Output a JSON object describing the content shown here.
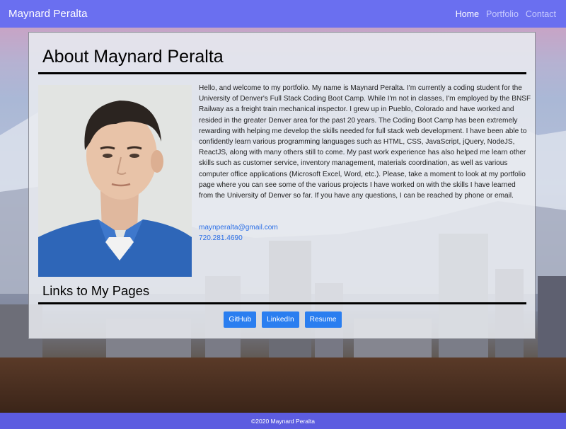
{
  "navbar": {
    "brand": "Maynard Peralta",
    "links": [
      {
        "label": "Home",
        "active": true
      },
      {
        "label": "Portfolio",
        "active": false
      },
      {
        "label": "Contact",
        "active": false
      }
    ]
  },
  "about": {
    "title": "About Maynard Peralta",
    "bio": "Hello, and welcome to my portfolio. My name is Maynard Peralta. I'm currently a coding student for the University of Denver's Full Stack Coding Boot Camp. While I'm not in classes, I'm employed by the BNSF Railway as a freight train mechanical inspector. I grew up in Pueblo, Colorado and have worked and resided in the greater Denver area for the past 20 years. The Coding Boot Camp has been extremely rewarding with helping me develop the skills needed for full stack web development. I have been able to confidently learn various programming languages such as HTML, CSS, JavaScript, jQuery, NodeJS, ReactJS, along with many others still to come. My past work experience has also helped me learn other skills such as customer service, inventory management, materials coordination, as well as various computer office applications (Microsoft Excel, Word, etc.). Please, take a moment to look at my portfolio page where you can see some of the various projects I have worked on with the skills I have learned from the University of Denver so far. If you have any questions, I can be reached by phone or email.",
    "email": "maynperalta@gmail.com",
    "phone": "720.281.4690"
  },
  "links_section": {
    "title": "Links to My Pages",
    "buttons": [
      "GitHub",
      "LinkedIn",
      "Resume"
    ]
  },
  "footer": {
    "text": "©2020 Maynard Peralta"
  },
  "colors": {
    "navbar": "#6a6ff0",
    "button": "#2a7ef0",
    "link": "#2a6ee6",
    "footer": "#5c5ce0"
  }
}
